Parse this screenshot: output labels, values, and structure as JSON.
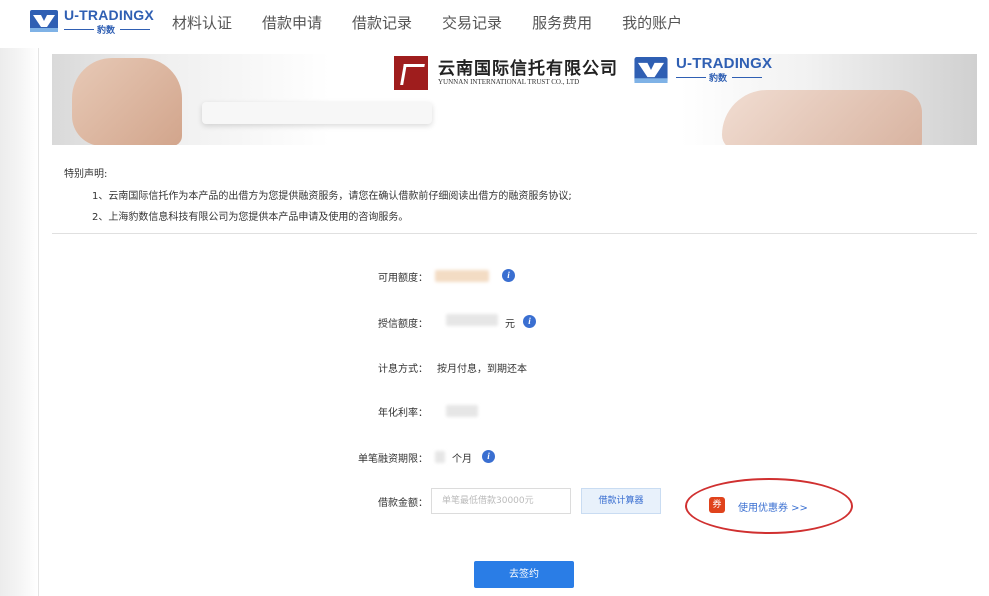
{
  "brand": {
    "name": "U-TRADINGX",
    "sub": "豹数"
  },
  "nav": [
    {
      "label": "材料认证"
    },
    {
      "label": "借款申请"
    },
    {
      "label": "借款记录"
    },
    {
      "label": "交易记录"
    },
    {
      "label": "服务费用"
    },
    {
      "label": "我的账户"
    }
  ],
  "banner": {
    "trust_name": "云南国际信托有限公司",
    "trust_en": "YUNNAN INTERNATIONAL TRUST CO., LTD",
    "partner_name": "U-TRADINGX",
    "partner_sub": "豹数"
  },
  "notice": {
    "title": "特别声明:",
    "lines": [
      "1、云南国际信托作为本产品的出借方为您提供融资服务，请您在确认借款前仔细阅读出借方的融资服务协议;",
      "2、上海豹数信息科技有限公司为您提供本产品申请及使用的咨询服务。"
    ]
  },
  "form": {
    "available_label": "可用额度：",
    "credit_label": "授信额度：",
    "credit_unit": "元",
    "interest_label": "计息方式：",
    "interest_value": "按月付息，到期还本",
    "rate_label": "年化利率：",
    "term_label": "单笔融资期限：",
    "term_unit": "个月",
    "amount_label": "借款金额：",
    "amount_placeholder": "单笔最低借款30000元",
    "calc_button": "借款计算器",
    "info_glyph": "i"
  },
  "coupon": {
    "badge": "券",
    "label": "使用优惠券 >>"
  },
  "submit": {
    "label": "去签约"
  },
  "colors": {
    "accent": "#2a7de6",
    "brand": "#2f5fb3",
    "highlight_ring": "#d03030"
  }
}
